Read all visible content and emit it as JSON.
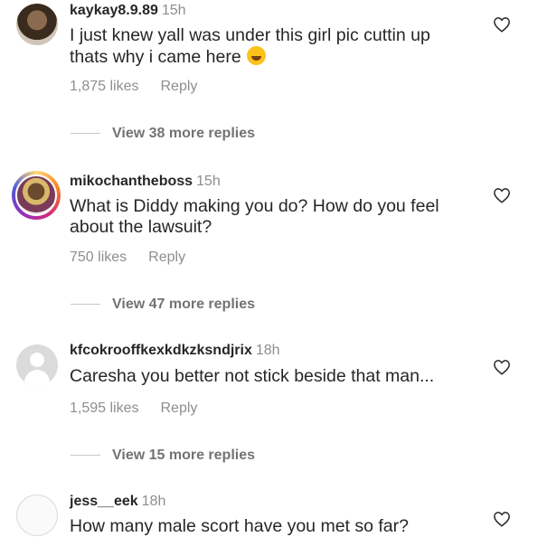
{
  "comments": [
    {
      "username": "kaykay8.9.89",
      "time": "15h",
      "text_line1": "I just knew yall was under this girl pic cuttin up",
      "text_line2": "thats why i came here",
      "emoji": "rolling-on-floor-laughing-emoji",
      "likes": "1,875 likes",
      "reply": "Reply",
      "view_replies": "View 38 more replies"
    },
    {
      "username": "mikochantheboss",
      "time": "15h",
      "text_line1": "What is Diddy making you do? How do you feel",
      "text_line2": "about the lawsuit?",
      "likes": "750 likes",
      "reply": "Reply",
      "view_replies": "View 47 more replies"
    },
    {
      "username": "kfcokrooffkexkdkzksndjrix",
      "time": "18h",
      "text_line1": "Caresha you better not stick beside that man...",
      "likes": "1,595 likes",
      "reply": "Reply",
      "view_replies": "View 15 more replies"
    },
    {
      "username": "jess__eek",
      "time": "18h",
      "text_line1": "How many male scort have you met so far?"
    }
  ]
}
